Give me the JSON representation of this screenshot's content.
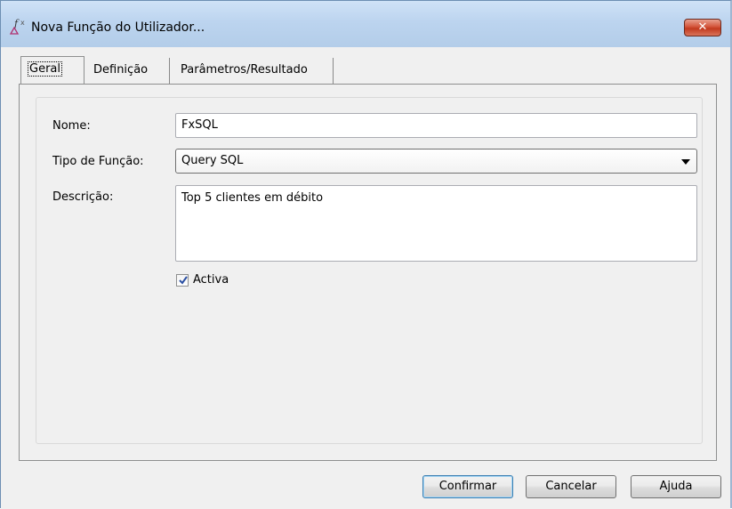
{
  "window": {
    "title": "Nova Função do Utilizador...",
    "close_label": "✕",
    "icon": "function-icon"
  },
  "tabs": [
    {
      "label": "Geral",
      "active": true
    },
    {
      "label": "Definição",
      "active": false
    },
    {
      "label": "Parâmetros/Resultado",
      "active": false
    }
  ],
  "form": {
    "nome_label": "Nome:",
    "nome_value": "FxSQL",
    "tipo_label": "Tipo de Função:",
    "tipo_value": "Query SQL",
    "descricao_label": "Descrição:",
    "descricao_value": "Top 5 clientes em débito",
    "activa_label": "Activa",
    "activa_checked": true
  },
  "buttons": {
    "confirmar": "Confirmar",
    "cancelar": "Cancelar",
    "ajuda": "Ajuda"
  },
  "colors": {
    "titlebar": "#bcd4ef",
    "close": "#c23a1f",
    "default_button_border": "#3c7fb1"
  }
}
